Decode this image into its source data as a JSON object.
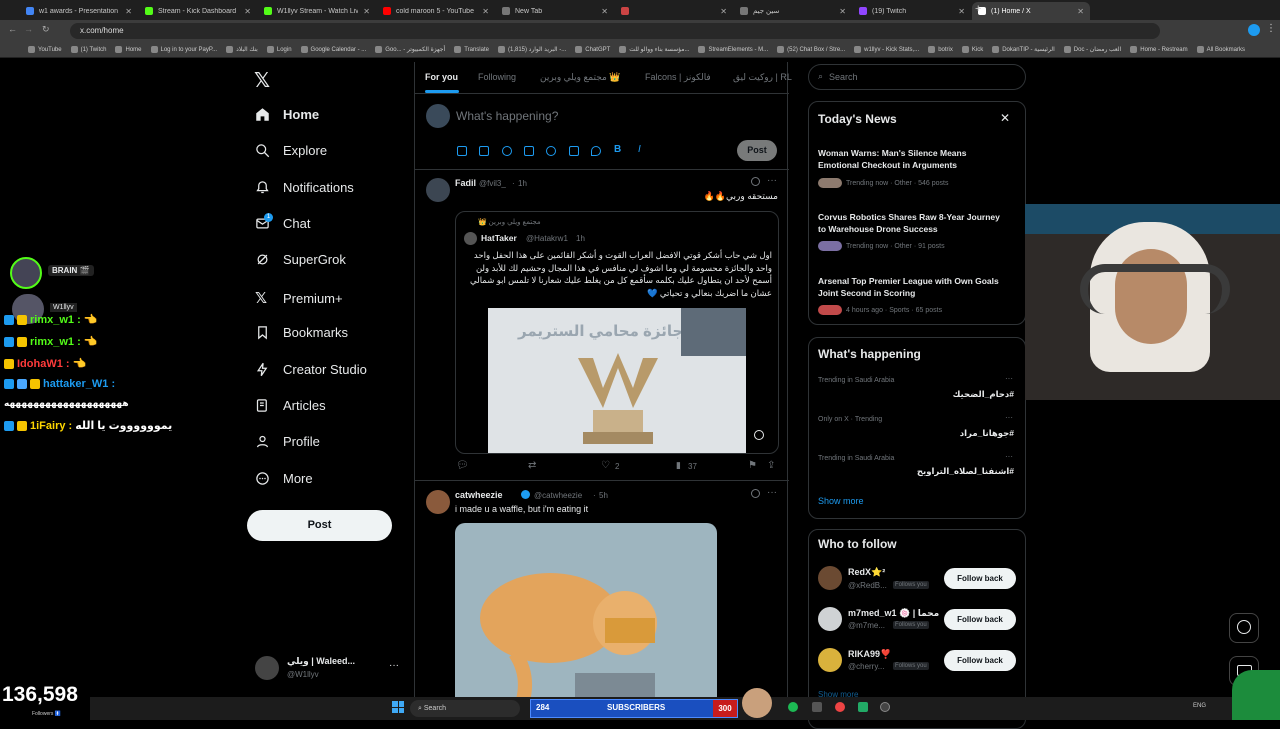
{
  "browser": {
    "tabs": [
      {
        "label": "w1 awards - Presentation",
        "color": "#4285f4"
      },
      {
        "label": "Stream - Kick Dashboard",
        "color": "#53fc18"
      },
      {
        "label": "W1llyv Stream - Watch Live on",
        "color": "#53fc18"
      },
      {
        "label": "cold maroon 5 - YouTube",
        "color": "#ff0000"
      },
      {
        "label": "New Tab",
        "color": "#777777"
      },
      {
        "label": "",
        "color": "#c44"
      },
      {
        "label": "سين جيم",
        "color": "#777777"
      },
      {
        "label": "(19) Twitch",
        "color": "#9146ff"
      },
      {
        "label": "(1) Home / X",
        "color": "#ffffff"
      }
    ],
    "url": "x.com/home",
    "bookmarks": [
      "YouTube",
      "(1) Twitch",
      "Home",
      "Log in to your PayP...",
      "بنك البلاد",
      "Login",
      "Google Calendar - ...",
      "Goo... - أجهزة الكمبيوتر",
      "Translate",
      "البريد الوارد (1,815) -...",
      "ChatGPT",
      "مؤسسة بناء ووالو للت...",
      "StreamElements - M...",
      "(52) Chat Box / Stre...",
      "w1llyv - Kick Stats,...",
      "botrix",
      "Kick",
      "DokanTIP - الرئيسية",
      "Doc - العب رمضان",
      "Home - Restream",
      "All Bookmarks"
    ]
  },
  "sidebar": {
    "items": [
      "Home",
      "Explore",
      "Notifications",
      "Chat",
      "SuperGrok",
      "Premium+",
      "Bookmarks",
      "Creator Studio",
      "Articles",
      "Profile",
      "More"
    ],
    "chat_badge": "1",
    "post_label": "Post",
    "account_name": "ويلي | Waleed...",
    "account_handle": "@W1llyv"
  },
  "feed": {
    "tabs": [
      "For you",
      "Following",
      "مجتمع ويلي وبرين 👑",
      "Falcons | فالكونز",
      "روكيت ليق | RL"
    ],
    "composer_placeholder": "What's happening?",
    "composer_post": "Post",
    "tweet1": {
      "name": "Fadil",
      "handle": "@fvil3_",
      "time": "1h",
      "text": "مستحقه وربي🔥🔥",
      "quote_community": "مجتمع ويلي وبرين 👑",
      "quote_name": "HatTaker",
      "quote_handle": "@Hatakrw1",
      "quote_time": "1h",
      "quote_text": "اول شي حاب أشكر قوتي الافضل العراب القوت و أشكر القائمين على هذا الحفل واحد واحد والجائزة محسومة لي وما اشوف لي منافس في هذا المجال وحشيم لك للأبد ولن أسمح لأحد ان يتطاول عليك بكلمه سأقمع كل من يغلط عليك شعارنا لا تلمس ابو شمالي عشان ما اضربك بنعالي و تحياتي 💙",
      "image_caption": "جائزة محامي الستريمر",
      "likes": "2",
      "views": "37"
    },
    "tweet2": {
      "name": "catwheezie",
      "handle": "@catwheezie",
      "time": "5h",
      "text": "i made u a waffle, but i'm eating it"
    }
  },
  "right": {
    "search_placeholder": "Search",
    "news_title": "Today's News",
    "news": [
      {
        "headline": "Woman Warns: Man's Silence Means Emotional Checkout in Arguments",
        "meta": "Trending now · Other · 546 posts"
      },
      {
        "headline": "Corvus Robotics Shares Raw 8-Year Journey to Warehouse Drone Success",
        "meta": "Trending now · Other · 91 posts"
      },
      {
        "headline": "Arsenal Top Premier League with Own Goals Joint Second in Scoring",
        "meta": "4 hours ago · Sports · 65 posts"
      }
    ],
    "happening_title": "What's happening",
    "trends": [
      {
        "category": "Trending in Saudi Arabia",
        "name": "#دحام_الضحيك"
      },
      {
        "category": "Only on X · Trending",
        "name": "#جوهانا_مراد"
      },
      {
        "category": "Trending in Saudi Arabia",
        "name": "#اشنفنا_لصلاه_التراويح"
      }
    ],
    "show_more": "Show more",
    "follow_title": "Who to follow",
    "follow": [
      {
        "name": "RedX⭐²",
        "handle": "@xRedB...",
        "tag": "Follows you",
        "button": "Follow back"
      },
      {
        "name": "m7med_w1 🍥 | محما",
        "handle": "@m7me...",
        "tag": "Follows you",
        "button": "Follow back"
      },
      {
        "name": "RIKA99❣️",
        "handle": "@cherry...",
        "tag": "Follows you",
        "button": "Follow back"
      }
    ],
    "show_more_2": "Show more"
  },
  "overlay": {
    "chat": [
      {
        "name": "BRAIN 🎬",
        "msg": ""
      },
      {
        "name": "W1llyv",
        "msg": ""
      },
      {
        "name": "rimx_w1 :",
        "msg": "👈",
        "color": "#53fc18"
      },
      {
        "name": "rimx_w1 :",
        "msg": "👈",
        "color": "#53fc18"
      },
      {
        "name": "IdohaW1 :",
        "msg": "👈",
        "color": "#ff3b3b"
      },
      {
        "name": "hattaker_W1 :",
        "msg": "",
        "color": "#1d9bf0"
      },
      {
        "name": "",
        "msg": "ههههههههههههههههههههه",
        "color": "#ffffff"
      },
      {
        "name": "1iFairy :",
        "msg": "يمووووووت يا الله",
        "color": "#ffd700"
      }
    ],
    "followers_count": "136,598",
    "followers_label": "Followers 🚹",
    "subs_current": "284",
    "subs_label": "SUBSCRIBERS",
    "subs_goal": "300",
    "subs_progress": 0.947
  },
  "taskbar": {
    "search": "Search",
    "lang": "ENG"
  }
}
